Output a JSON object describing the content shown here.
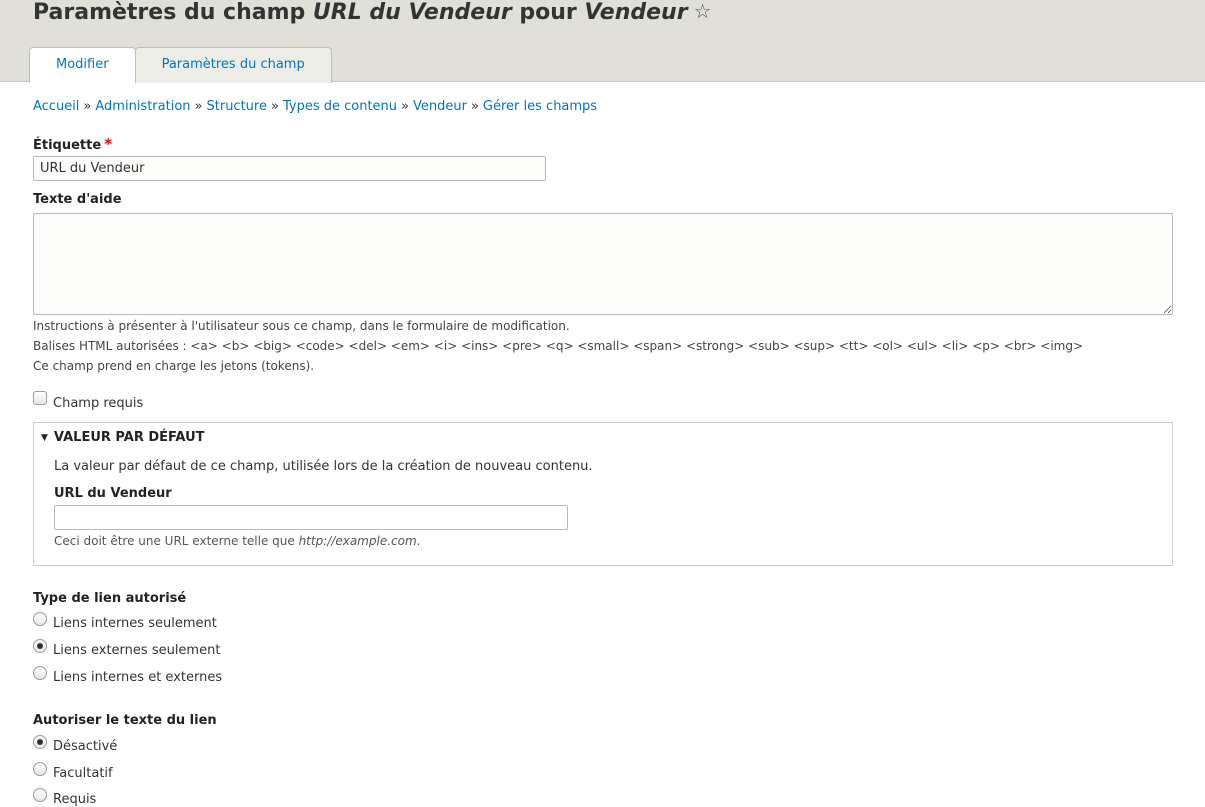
{
  "header": {
    "title_prefix": "Paramètres du champ ",
    "title_field": "URL du Vendeur",
    "title_mid": " pour ",
    "title_type": "Vendeur",
    "star_icon": "star-outline-icon",
    "tabs": [
      {
        "label": "Modifier",
        "active": true
      },
      {
        "label": "Paramètres du champ",
        "active": false
      }
    ]
  },
  "breadcrumb": [
    "Accueil",
    "Administration",
    "Structure",
    "Types de contenu",
    "Vendeur",
    "Gérer les champs"
  ],
  "breadcrumb_separator": "»",
  "form": {
    "etiquette_label": "Étiquette",
    "required_marker": "*",
    "etiquette_value": "URL du Vendeur",
    "aide_label": "Texte d'aide",
    "aide_value": "",
    "aide_desc_1": "Instructions à présenter à l'utilisateur sous ce champ, dans le formulaire de modification.",
    "aide_desc_2": "Balises HTML autorisées : <a> <b> <big> <code> <del> <em> <i> <ins> <pre> <q> <small> <span> <strong> <sub> <sup> <tt> <ol> <ul> <li> <p> <br> <img>",
    "aide_desc_3": "Ce champ prend en charge les jetons (tokens).",
    "champ_requis_label": "Champ requis",
    "champ_requis_checked": false
  },
  "default_value": {
    "legend": "VALEUR PAR DÉFAUT",
    "description": "La valeur par défaut de ce champ, utilisée lors de la création de nouveau contenu.",
    "field_label": "URL du Vendeur",
    "field_value": "",
    "hint_prefix": "Ceci doit être une URL externe telle que ",
    "hint_example": "http://example.com",
    "hint_suffix": "."
  },
  "link_type": {
    "label": "Type de lien autorisé",
    "options": [
      {
        "label": "Liens internes seulement",
        "checked": false
      },
      {
        "label": "Liens externes seulement",
        "checked": true
      },
      {
        "label": "Liens internes et externes",
        "checked": false
      }
    ]
  },
  "link_text": {
    "label": "Autoriser le texte du lien",
    "options": [
      {
        "label": "Désactivé",
        "checked": true
      },
      {
        "label": "Facultatif",
        "checked": false
      },
      {
        "label": "Requis",
        "checked": false
      }
    ]
  }
}
